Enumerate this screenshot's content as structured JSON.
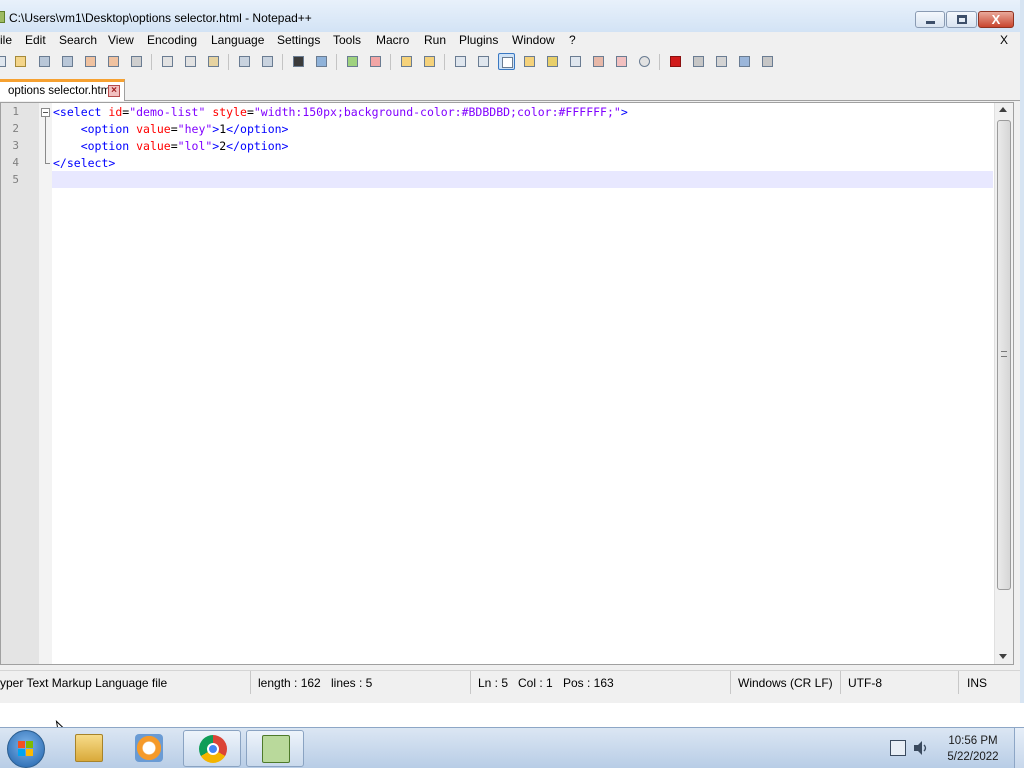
{
  "window": {
    "title": "C:\\Users\\vm1\\Desktop\\options selector.html - Notepad++",
    "close_glyph": "X"
  },
  "menu": {
    "items": [
      "ile",
      "Edit",
      "Search",
      "View",
      "Encoding",
      "Language",
      "Settings",
      "Tools",
      "Macro",
      "Run",
      "Plugins",
      "Window",
      "?"
    ],
    "close_doc": "X"
  },
  "toolbar": {
    "icons": [
      "new-file-icon",
      "open-file-icon",
      "save-icon",
      "save-all-icon",
      "close-icon",
      "close-all-icon",
      "print-icon",
      "cut-icon",
      "copy-icon",
      "paste-icon",
      "undo-icon",
      "redo-icon",
      "find-icon",
      "replace-icon",
      "zoom-in-icon",
      "zoom-out-icon",
      "sync-vertical-icon",
      "sync-horizontal-icon",
      "word-wrap-icon",
      "show-all-chars-icon",
      "indent-guide-icon",
      "user-language-icon",
      "doc-map-icon",
      "doc-list-icon",
      "function-list-icon",
      "folder-workspace-icon",
      "monitoring-icon",
      "record-macro-icon",
      "stop-macro-icon",
      "play-macro-icon",
      "run-macro-multiple-icon",
      "save-macro-icon"
    ]
  },
  "tab": {
    "label": "options selector.html",
    "close_glyph": "×"
  },
  "editor": {
    "line_numbers": [
      "1",
      "2",
      "3",
      "4",
      "5"
    ],
    "line1": {
      "open": "<select",
      "sp1": " ",
      "attr1": "id",
      "eq1": "=",
      "val1": "\"demo-list\"",
      "sp2": " ",
      "attr2": "style",
      "eq2": "=",
      "val2": "\"width:150px;background-color:#BDBDBD;color:#FFFFFF;\"",
      "close": ">"
    },
    "line2": {
      "indent": "    ",
      "open": "<option",
      "sp": " ",
      "attr": "value",
      "eq": "=",
      "val": "\"hey\"",
      "close": ">",
      "text": "1",
      "end": "</option>"
    },
    "line3": {
      "indent": "    ",
      "open": "<option",
      "sp": " ",
      "attr": "value",
      "eq": "=",
      "val": "\"lol\"",
      "close": ">",
      "text": "2",
      "end": "</option>"
    },
    "line4": {
      "end": "</select>"
    },
    "syntax_colors": {
      "tag": "#0000ff",
      "attribute": "#ff0000",
      "value": "#8000ff"
    }
  },
  "status": {
    "file_type": "yper Text Markup Language file",
    "length": "length : 162",
    "lines": "lines : 5",
    "ln": "Ln : 5",
    "col": "Col : 1",
    "pos": "Pos : 163",
    "eol": "Windows (CR LF)",
    "encoding": "UTF-8",
    "mode": "INS"
  },
  "taskbar": {
    "apps": [
      "file-explorer-icon",
      "media-player-icon",
      "chrome-icon",
      "notepad-plus-plus-icon"
    ],
    "time": "10:56 PM",
    "date": "5/22/2022"
  }
}
